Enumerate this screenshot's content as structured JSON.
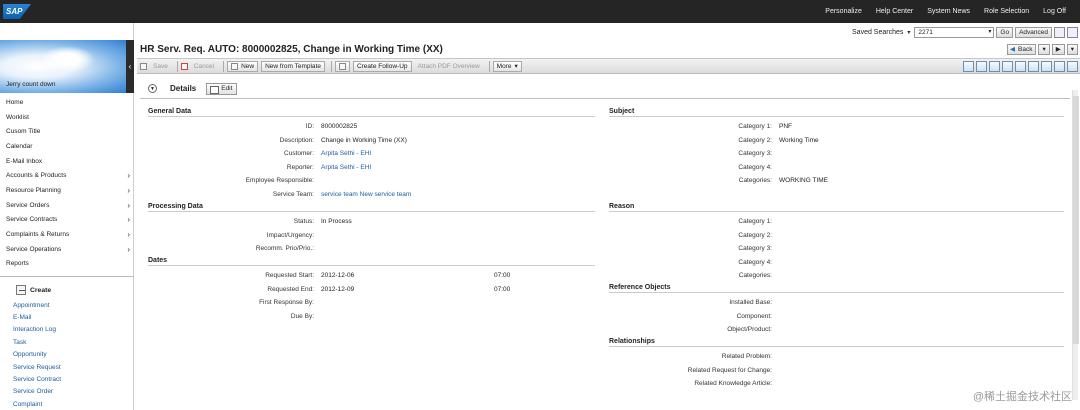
{
  "top": {
    "logo": "SAP",
    "links": [
      "Personalize",
      "Help Center",
      "System News",
      "Role Selection",
      "Log Off"
    ]
  },
  "sidebar": {
    "user": "Jerry count down",
    "collapse_glyph": "‹",
    "items": [
      {
        "label": "Home",
        "arrow": false
      },
      {
        "label": "Worklist",
        "arrow": false
      },
      {
        "label": "Cusom Title",
        "arrow": false
      },
      {
        "label": "Calendar",
        "arrow": false
      },
      {
        "label": "E-Mail Inbox",
        "arrow": false
      },
      {
        "label": "Accounts & Products",
        "arrow": true
      },
      {
        "label": "Resource Planning",
        "arrow": true
      },
      {
        "label": "Service Orders",
        "arrow": true
      },
      {
        "label": "Service Contracts",
        "arrow": true
      },
      {
        "label": "Complaints & Returns",
        "arrow": true
      },
      {
        "label": "Service Operations",
        "arrow": true
      },
      {
        "label": "Reports",
        "arrow": false
      }
    ],
    "create_title": "Create",
    "create_items": [
      "Appointment",
      "E-Mail",
      "Interaction Log",
      "Task",
      "Opportunity",
      "Service Request",
      "Service Contract",
      "Service Order",
      "Complaint"
    ]
  },
  "header": {
    "title": "HR Serv. Req. AUTO: 8000002825, Change in Working Time (XX)",
    "saved_searches_label": "Saved Searches",
    "search_value": "2271",
    "go": "Go",
    "advanced": "Advanced",
    "back": "Back"
  },
  "toolbar": {
    "save": "Save",
    "cancel": "Cancel",
    "new": "New",
    "new_from_template": "New from Template",
    "create_follow_up": "Create Follow-Up",
    "attach_pdf": "Attach PDF Overview",
    "more": "More"
  },
  "details": {
    "title": "Details",
    "edit": "Edit",
    "general": {
      "heading": "General Data",
      "rows": [
        {
          "label": "ID:",
          "value": "8000002825",
          "link": false
        },
        {
          "label": "Description:",
          "value": "Change in Working Time (XX)",
          "link": false
        },
        {
          "label": "Customer:",
          "value": "Arpita Sethi - EHI",
          "link": true
        },
        {
          "label": "Reporter:",
          "value": "Arpita Sethi - EHI",
          "link": true
        },
        {
          "label": "Employee Responsible:",
          "value": "",
          "link": false
        },
        {
          "label": "Service Team:",
          "value": "service team New service team",
          "link": true
        }
      ]
    },
    "processing": {
      "heading": "Processing Data",
      "rows": [
        {
          "label": "Status:",
          "value": "In Process"
        },
        {
          "label": "Impact/Urgency:",
          "value": ""
        },
        {
          "label": "Recomm. Prio/Prio.:",
          "value": ""
        }
      ]
    },
    "dates": {
      "heading": "Dates",
      "rows": [
        {
          "label": "Requested Start:",
          "date": "2012-12-06",
          "time": "07:00"
        },
        {
          "label": "Requested End:",
          "date": "2012-12-09",
          "time": "07:00"
        },
        {
          "label": "First Response By:",
          "date": "",
          "time": ""
        },
        {
          "label": "Due By:",
          "date": "",
          "time": ""
        }
      ]
    },
    "subject": {
      "heading": "Subject",
      "rows": [
        {
          "label": "Category 1:",
          "value": "PNF"
        },
        {
          "label": "Category 2:",
          "value": "Working Time"
        },
        {
          "label": "Category 3:",
          "value": ""
        },
        {
          "label": "Category 4:",
          "value": ""
        },
        {
          "label": "Categories:",
          "value": "WORKING TIME"
        }
      ]
    },
    "reason": {
      "heading": "Reason",
      "rows": [
        {
          "label": "Category 1:",
          "value": ""
        },
        {
          "label": "Category 2:",
          "value": ""
        },
        {
          "label": "Category 3:",
          "value": ""
        },
        {
          "label": "Category 4:",
          "value": ""
        },
        {
          "label": "Categories:",
          "value": ""
        }
      ]
    },
    "reference": {
      "heading": "Reference Objects",
      "rows": [
        {
          "label": "Installed Base:",
          "value": ""
        },
        {
          "label": "Component:",
          "value": ""
        },
        {
          "label": "Object/Product:",
          "value": ""
        }
      ]
    },
    "relationships": {
      "heading": "Relationships",
      "rows": [
        {
          "label": "Related Problem:",
          "value": ""
        },
        {
          "label": "Related Request for Change:",
          "value": ""
        },
        {
          "label": "Related Knowledge Article:",
          "value": ""
        }
      ]
    }
  },
  "watermark": "@稀土掘金技术社区"
}
